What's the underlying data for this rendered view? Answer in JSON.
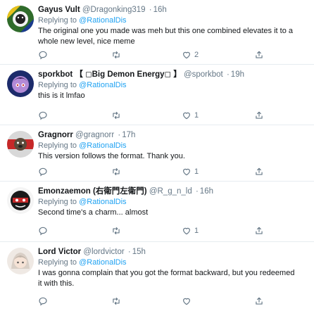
{
  "tweets": [
    {
      "name": "Gayus Vult",
      "handle": "@Dragonking319",
      "time": "16h",
      "reply_prefix": "Replying to",
      "reply_to": "@RationalDis",
      "lines": [
        "The original one you made was meh but this one combined elevates it to a",
        "whole new level, nice meme"
      ],
      "likes": "2",
      "avatar_icon": "lion-avatar-icon"
    },
    {
      "name": "sporkbot 【 ◻Big Demon Energy◻ 】",
      "handle": "@sporkbot",
      "time": "19h",
      "reply_prefix": "Replying to",
      "reply_to": "@RationalDis",
      "lines": [
        "this is it lmfao"
      ],
      "likes": "1",
      "avatar_icon": "character-avatar-icon"
    },
    {
      "name": "Gragnorr",
      "handle": "@gragnorr",
      "time": "17h",
      "reply_prefix": "Replying to",
      "reply_to": "@RationalDis",
      "lines": [
        "This version follows the format. Thank you."
      ],
      "likes": "1",
      "avatar_icon": "dog-avatar-icon"
    },
    {
      "name": "Emonzaemon (右衛門左衛門)",
      "handle": "@R_g_n_ld",
      "time": "16h",
      "reply_prefix": "Replying to",
      "reply_to": "@RationalDis",
      "lines": [
        "Second time's a charm... almost"
      ],
      "likes": "1",
      "avatar_icon": "masked-avatar-icon"
    },
    {
      "name": "Lord Victor",
      "handle": "@lordvictor",
      "time": "15h",
      "reply_prefix": "Replying to",
      "reply_to": "@RationalDis",
      "lines": [
        "I was gonna complain that you got the format backward, but you redeemed",
        "it with this."
      ],
      "likes": "",
      "avatar_icon": "anime-avatar-icon"
    }
  ],
  "colors": {
    "text": "#14171a",
    "secondary": "#657786",
    "link": "#1da1f2",
    "divider": "#e6ecf0"
  },
  "icons": [
    "reply-icon",
    "retweet-icon",
    "like-icon",
    "share-icon"
  ]
}
